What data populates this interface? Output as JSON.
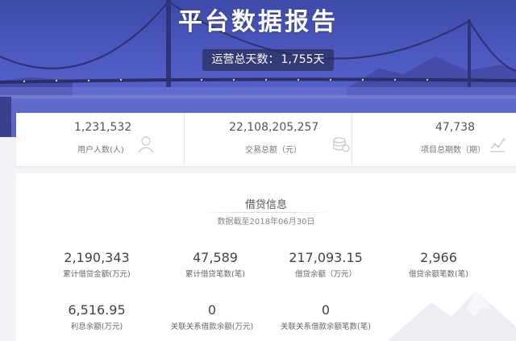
{
  "banner": {
    "title": "平台数据报告",
    "days_label": "运营总天数：",
    "days_value": "1,755天"
  },
  "stats": [
    {
      "value": "1,231,532",
      "label": "用户人数(人)",
      "icon": "user-icon"
    },
    {
      "value": "22,108,205,257",
      "label": "交易总额（元）",
      "icon": "coins-icon"
    },
    {
      "value": "47,738",
      "label": "项目总期数（期）",
      "icon": "chart-icon"
    }
  ],
  "loan": {
    "title": "借贷信息",
    "date_note": "数据截至2018年06月30日",
    "metrics": [
      {
        "value": "2,190,343",
        "label": "累计借贷金额(万元)"
      },
      {
        "value": "47,589",
        "label": "累计借贷笔数(笔)"
      },
      {
        "value": "217,093.15",
        "label": "借贷余额（万元）"
      },
      {
        "value": "2,966",
        "label": "借贷余额笔数(笔)"
      },
      {
        "value": "6,516.95",
        "label": "利息余额(万元)"
      },
      {
        "value": "0",
        "label": "关联关系借款余额(万元)"
      },
      {
        "value": "0",
        "label": "关联关系借款余额笔数(笔)"
      }
    ]
  },
  "colors": {
    "banner": "#4f5bc4",
    "badge": "#282e5a",
    "card": "#ffffff",
    "background": "#f2f3f7"
  }
}
